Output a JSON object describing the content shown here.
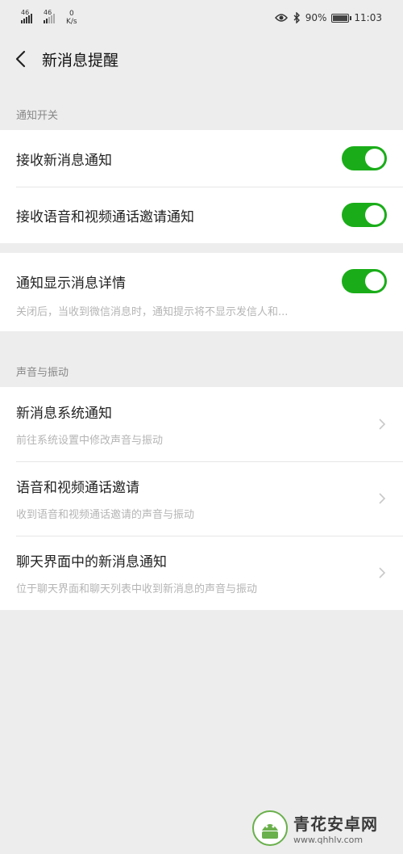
{
  "status": {
    "signal1": "46",
    "signal2": "46",
    "net_speed": "0",
    "net_unit": "K/s",
    "battery": "90%",
    "time": "11:03",
    "battery_level": 0.9
  },
  "header": {
    "title": "新消息提醒"
  },
  "section_notify": {
    "label": "通知开关",
    "items": [
      {
        "label": "接收新消息通知",
        "on": true
      },
      {
        "label": "接收语音和视频通话邀请通知",
        "on": true
      }
    ]
  },
  "details": {
    "label": "通知显示消息详情",
    "on": true,
    "desc": "关闭后，当收到微信消息时，通知提示将不显示发信人和..."
  },
  "section_sound": {
    "label": "声音与振动",
    "items": [
      {
        "label": "新消息系统通知",
        "desc": "前往系统设置中修改声音与振动"
      },
      {
        "label": "语音和视频通话邀请",
        "desc": "收到语音和视频通话邀请的声音与振动"
      },
      {
        "label": "聊天界面中的新消息通知",
        "desc": "位于聊天界面和聊天列表中收到新消息的声音与振动"
      }
    ]
  },
  "watermark": {
    "name": "青花安卓网",
    "url": "www.qhhlv.com"
  },
  "colors": {
    "toggle_on": "#1aad19",
    "background": "#ededed"
  },
  "icons": {
    "back": "chevron-left-icon",
    "nav": "chevron-right-icon",
    "eye": "eye-icon",
    "bluetooth": "bluetooth-icon"
  }
}
